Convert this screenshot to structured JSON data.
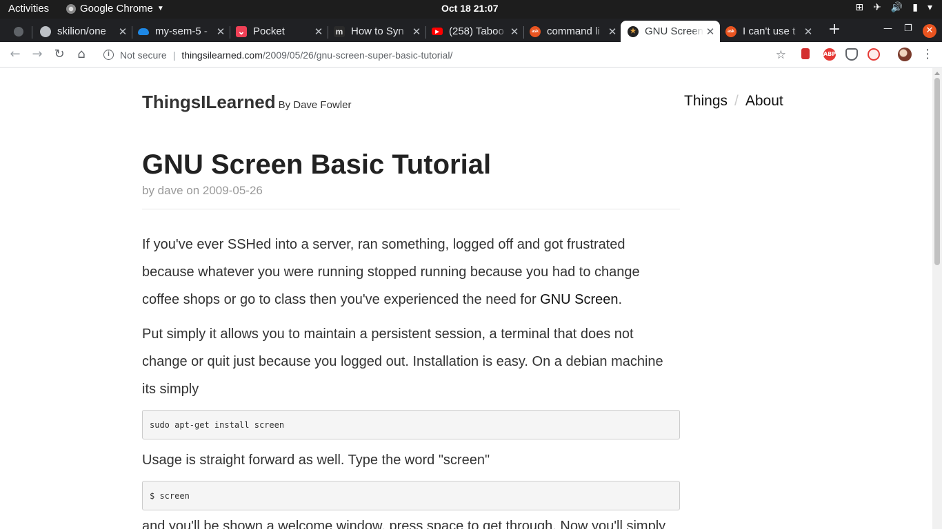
{
  "topbar": {
    "activities": "Activities",
    "app_name": "Google Chrome",
    "clock": "Oct 18  21:07"
  },
  "tabs": [
    {
      "title": "skilion/one",
      "favicon": "github-icon",
      "color": "#e8eaed"
    },
    {
      "title": "my-sem-5 - ",
      "favicon": "onedrive-icon",
      "color": "#1e88e5"
    },
    {
      "title": "Pocket",
      "favicon": "pocket-icon",
      "color": "#ef4056"
    },
    {
      "title": "How to Syn",
      "favicon": "m-icon",
      "color": "#2b2b2b"
    },
    {
      "title": "(258) Taboo",
      "favicon": "youtube-icon",
      "color": "#ff0000"
    },
    {
      "title": "command li",
      "favicon": "askubuntu-icon",
      "color": "#e95420"
    },
    {
      "title": "GNU Screen",
      "favicon": "site-favicon-icon",
      "color": "#222222"
    },
    {
      "title": "I can't use t",
      "favicon": "askubuntu-icon",
      "color": "#e95420"
    }
  ],
  "toolbar": {
    "not_secure": "Not secure",
    "url_host": "thingsilearned.com",
    "url_path": "/2009/05/26/gnu-screen-super-basic-tutorial/"
  },
  "extensions": [
    {
      "name": "bookmark-ext-icon",
      "label": "",
      "color": "#d32f2f"
    },
    {
      "name": "adblock-ext-icon",
      "label": "ABP",
      "color": "#e53935"
    },
    {
      "name": "pocket-ext-icon",
      "label": "",
      "color": "#5f6368"
    },
    {
      "name": "cycle-ext-icon",
      "label": "",
      "color": "#e53935"
    }
  ],
  "site": {
    "name": "ThingsILearned",
    "byline": "By Dave Fowler",
    "nav": [
      "Things",
      "About"
    ]
  },
  "post": {
    "title": "GNU Screen Basic Tutorial",
    "meta": "by dave on 2009-05-26",
    "p1_text": "If you've ever SSHed into a server, ran something, logged off and got frustrated because whatever you were running stopped running because you had to change coffee shops or go to class then you've experienced the need for ",
    "p1_link": "GNU Screen",
    "p1_end": ".",
    "p2": "Put simply it allows you to maintain a persistent session, a terminal that does not change or quit just because you logged out. Installation is easy. On a debian machine its simply",
    "code1": "sudo apt-get install screen",
    "p3": "Usage is straight forward as well. Type the word \"screen\"",
    "code2": "$ screen",
    "p4": "and you'll be shown a welcome window, press space to get through. Now you'll simply"
  }
}
